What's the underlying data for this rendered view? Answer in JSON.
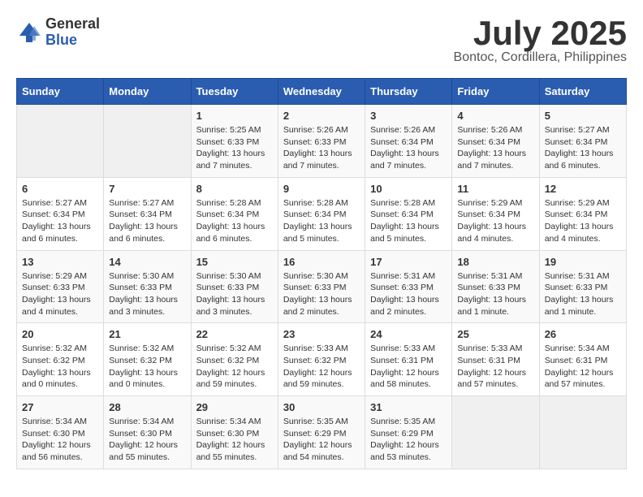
{
  "header": {
    "logo_general": "General",
    "logo_blue": "Blue",
    "month": "July 2025",
    "location": "Bontoc, Cordillera, Philippines"
  },
  "days_of_week": [
    "Sunday",
    "Monday",
    "Tuesday",
    "Wednesday",
    "Thursday",
    "Friday",
    "Saturday"
  ],
  "weeks": [
    [
      {
        "day": "",
        "info": ""
      },
      {
        "day": "",
        "info": ""
      },
      {
        "day": "1",
        "info": "Sunrise: 5:25 AM\nSunset: 6:33 PM\nDaylight: 13 hours and 7 minutes."
      },
      {
        "day": "2",
        "info": "Sunrise: 5:26 AM\nSunset: 6:33 PM\nDaylight: 13 hours and 7 minutes."
      },
      {
        "day": "3",
        "info": "Sunrise: 5:26 AM\nSunset: 6:34 PM\nDaylight: 13 hours and 7 minutes."
      },
      {
        "day": "4",
        "info": "Sunrise: 5:26 AM\nSunset: 6:34 PM\nDaylight: 13 hours and 7 minutes."
      },
      {
        "day": "5",
        "info": "Sunrise: 5:27 AM\nSunset: 6:34 PM\nDaylight: 13 hours and 6 minutes."
      }
    ],
    [
      {
        "day": "6",
        "info": "Sunrise: 5:27 AM\nSunset: 6:34 PM\nDaylight: 13 hours and 6 minutes."
      },
      {
        "day": "7",
        "info": "Sunrise: 5:27 AM\nSunset: 6:34 PM\nDaylight: 13 hours and 6 minutes."
      },
      {
        "day": "8",
        "info": "Sunrise: 5:28 AM\nSunset: 6:34 PM\nDaylight: 13 hours and 6 minutes."
      },
      {
        "day": "9",
        "info": "Sunrise: 5:28 AM\nSunset: 6:34 PM\nDaylight: 13 hours and 5 minutes."
      },
      {
        "day": "10",
        "info": "Sunrise: 5:28 AM\nSunset: 6:34 PM\nDaylight: 13 hours and 5 minutes."
      },
      {
        "day": "11",
        "info": "Sunrise: 5:29 AM\nSunset: 6:34 PM\nDaylight: 13 hours and 4 minutes."
      },
      {
        "day": "12",
        "info": "Sunrise: 5:29 AM\nSunset: 6:34 PM\nDaylight: 13 hours and 4 minutes."
      }
    ],
    [
      {
        "day": "13",
        "info": "Sunrise: 5:29 AM\nSunset: 6:33 PM\nDaylight: 13 hours and 4 minutes."
      },
      {
        "day": "14",
        "info": "Sunrise: 5:30 AM\nSunset: 6:33 PM\nDaylight: 13 hours and 3 minutes."
      },
      {
        "day": "15",
        "info": "Sunrise: 5:30 AM\nSunset: 6:33 PM\nDaylight: 13 hours and 3 minutes."
      },
      {
        "day": "16",
        "info": "Sunrise: 5:30 AM\nSunset: 6:33 PM\nDaylight: 13 hours and 2 minutes."
      },
      {
        "day": "17",
        "info": "Sunrise: 5:31 AM\nSunset: 6:33 PM\nDaylight: 13 hours and 2 minutes."
      },
      {
        "day": "18",
        "info": "Sunrise: 5:31 AM\nSunset: 6:33 PM\nDaylight: 13 hours and 1 minute."
      },
      {
        "day": "19",
        "info": "Sunrise: 5:31 AM\nSunset: 6:33 PM\nDaylight: 13 hours and 1 minute."
      }
    ],
    [
      {
        "day": "20",
        "info": "Sunrise: 5:32 AM\nSunset: 6:32 PM\nDaylight: 13 hours and 0 minutes."
      },
      {
        "day": "21",
        "info": "Sunrise: 5:32 AM\nSunset: 6:32 PM\nDaylight: 13 hours and 0 minutes."
      },
      {
        "day": "22",
        "info": "Sunrise: 5:32 AM\nSunset: 6:32 PM\nDaylight: 12 hours and 59 minutes."
      },
      {
        "day": "23",
        "info": "Sunrise: 5:33 AM\nSunset: 6:32 PM\nDaylight: 12 hours and 59 minutes."
      },
      {
        "day": "24",
        "info": "Sunrise: 5:33 AM\nSunset: 6:31 PM\nDaylight: 12 hours and 58 minutes."
      },
      {
        "day": "25",
        "info": "Sunrise: 5:33 AM\nSunset: 6:31 PM\nDaylight: 12 hours and 57 minutes."
      },
      {
        "day": "26",
        "info": "Sunrise: 5:34 AM\nSunset: 6:31 PM\nDaylight: 12 hours and 57 minutes."
      }
    ],
    [
      {
        "day": "27",
        "info": "Sunrise: 5:34 AM\nSunset: 6:30 PM\nDaylight: 12 hours and 56 minutes."
      },
      {
        "day": "28",
        "info": "Sunrise: 5:34 AM\nSunset: 6:30 PM\nDaylight: 12 hours and 55 minutes."
      },
      {
        "day": "29",
        "info": "Sunrise: 5:34 AM\nSunset: 6:30 PM\nDaylight: 12 hours and 55 minutes."
      },
      {
        "day": "30",
        "info": "Sunrise: 5:35 AM\nSunset: 6:29 PM\nDaylight: 12 hours and 54 minutes."
      },
      {
        "day": "31",
        "info": "Sunrise: 5:35 AM\nSunset: 6:29 PM\nDaylight: 12 hours and 53 minutes."
      },
      {
        "day": "",
        "info": ""
      },
      {
        "day": "",
        "info": ""
      }
    ]
  ]
}
